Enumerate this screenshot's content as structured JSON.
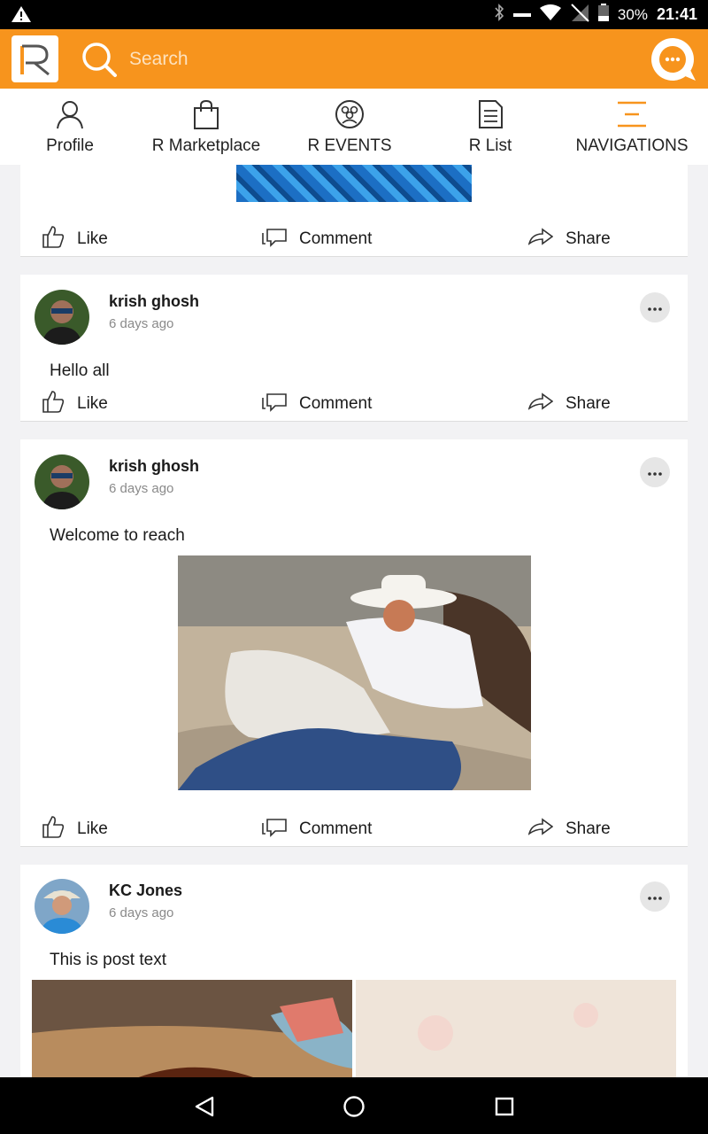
{
  "status_bar": {
    "battery": "30%",
    "time": "21:41"
  },
  "header": {
    "search_placeholder": "Search"
  },
  "tabs": [
    {
      "label": "Profile",
      "icon": "person-icon"
    },
    {
      "label": "R Marketplace",
      "icon": "shopping-bag-icon"
    },
    {
      "label": "R EVENTS",
      "icon": "events-icon"
    },
    {
      "label": "R List",
      "icon": "document-icon"
    },
    {
      "label": "NAVIGATIONS",
      "icon": "menu-icon"
    }
  ],
  "actions": {
    "like": "Like",
    "comment": "Comment",
    "share": "Share"
  },
  "posts": [
    {
      "author": "krish ghosh",
      "time": "6 days ago",
      "text": "Hello all"
    },
    {
      "author": "krish ghosh",
      "time": "6 days ago",
      "text": "Welcome to reach"
    },
    {
      "author": "KC Jones",
      "time": "6 days ago",
      "text": "This is post text"
    }
  ],
  "colors": {
    "brand": "#f7941d",
    "background": "#f2f2f4"
  }
}
